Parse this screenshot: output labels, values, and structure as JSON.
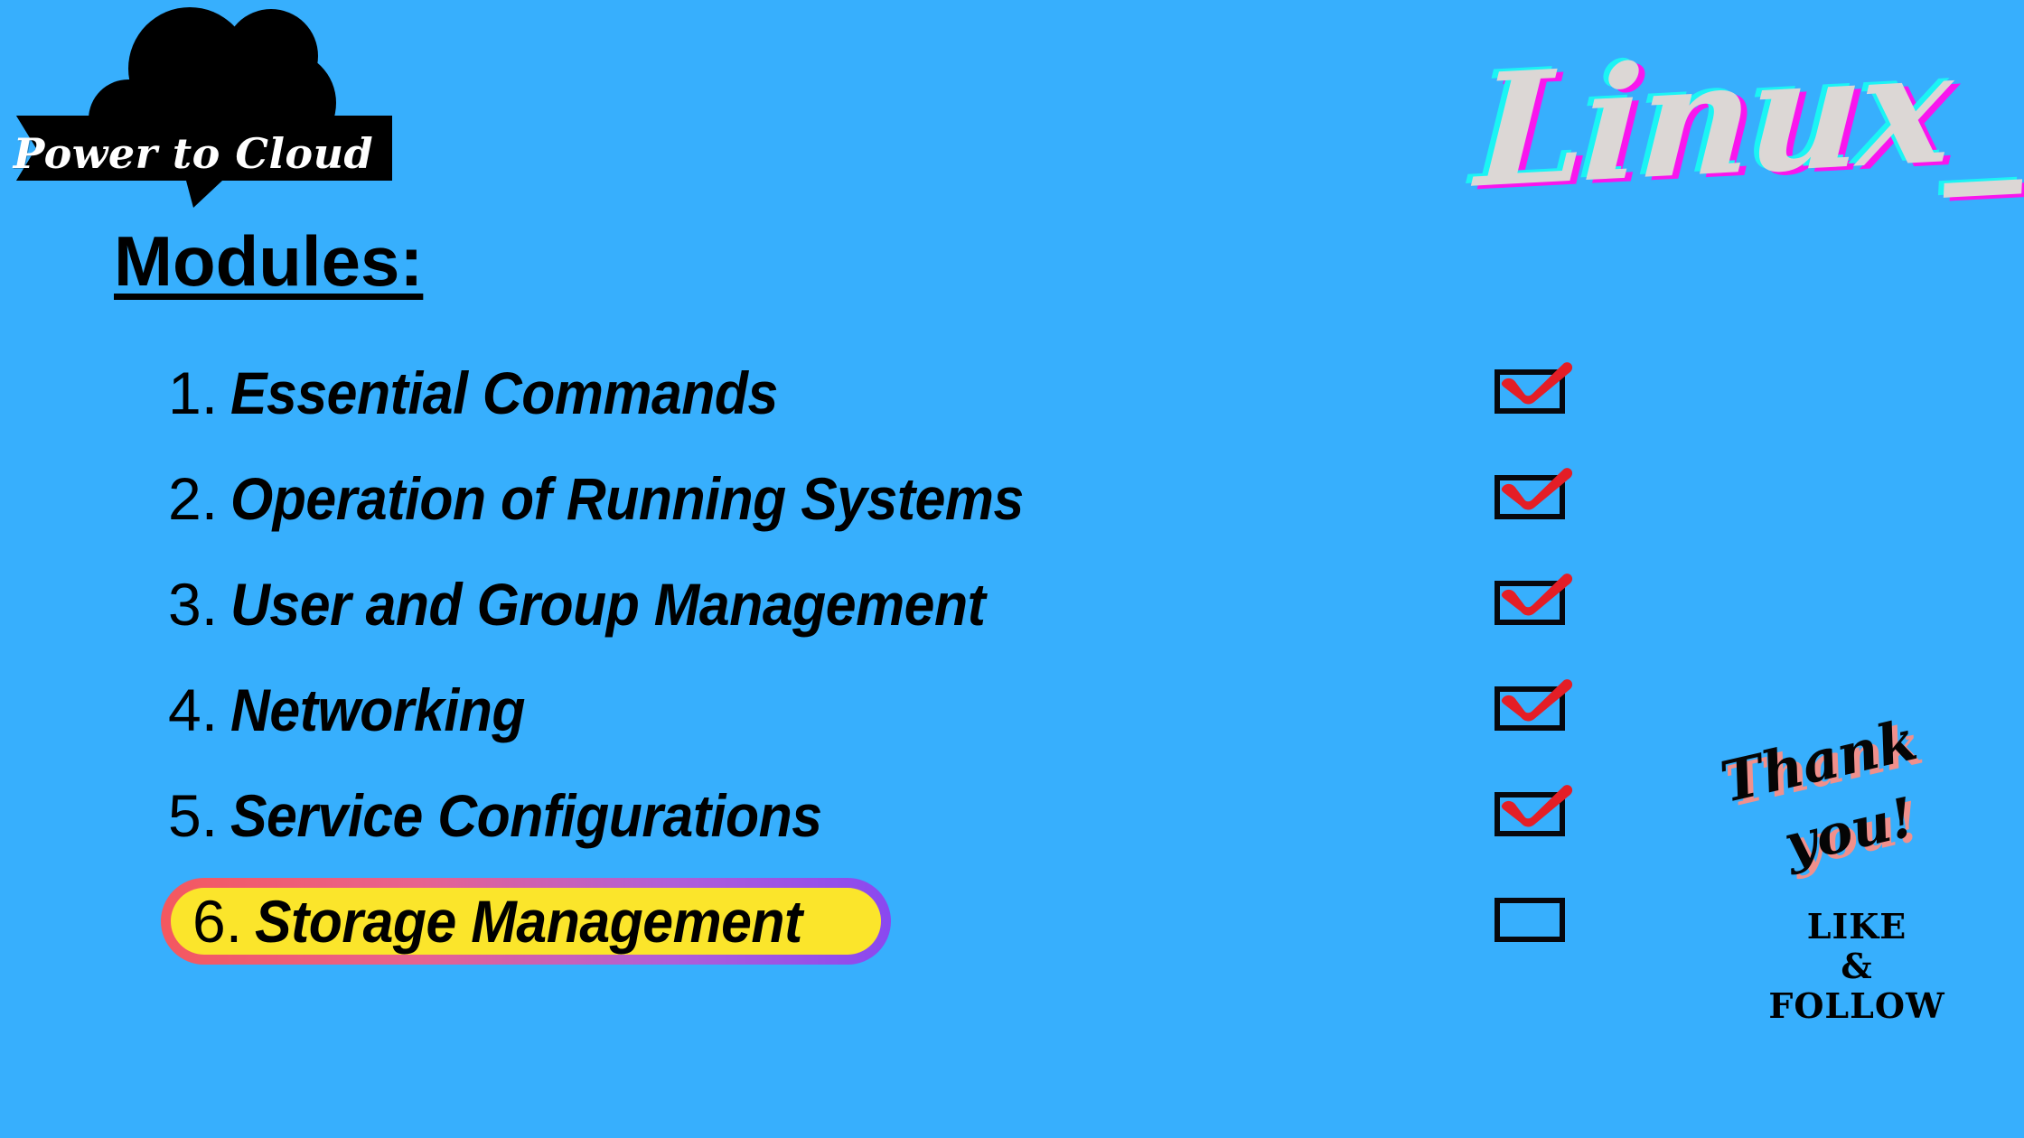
{
  "background_color": "#37AFFD",
  "logo": {
    "name": "power-to-cloud-logo",
    "banner_text": "Power to Cloud",
    "cloud_color": "#000000",
    "banner_color": "#000000",
    "banner_text_color": "#FFFFFF"
  },
  "wordmark": {
    "text": "Linux_",
    "fill_color": "#DCD7D5",
    "shadow_cyan": "#1BF4F4",
    "shadow_magenta": "#F915EE"
  },
  "heading": {
    "text": "Modules:"
  },
  "modules": [
    {
      "number": "1.",
      "name": "Essential Commands",
      "checked": true,
      "highlighted": false
    },
    {
      "number": "2.",
      "name": "Operation of Running Systems",
      "checked": true,
      "highlighted": false
    },
    {
      "number": "3.",
      "name": "User and Group Management",
      "checked": true,
      "highlighted": false
    },
    {
      "number": "4.",
      "name": "Networking",
      "checked": true,
      "highlighted": false
    },
    {
      "number": "5.",
      "name": "Service Configurations",
      "checked": true,
      "highlighted": false
    },
    {
      "number": "6.",
      "name": "Storage Management",
      "checked": false,
      "highlighted": true
    }
  ],
  "checkbox": {
    "border_color": "#07080D",
    "check_color": "#E41E26",
    "checked_count": 5,
    "total_count": 6
  },
  "highlight": {
    "fill_color": "#FBE52B",
    "border_gradient_start": "#F4585F",
    "border_gradient_end": "#8A48F0"
  },
  "thank_you": {
    "line1": "Thank",
    "line2": "you!",
    "shadow_color": "#F0908C",
    "like": "LIKE",
    "amp": "&",
    "follow": "FOLLOW"
  }
}
